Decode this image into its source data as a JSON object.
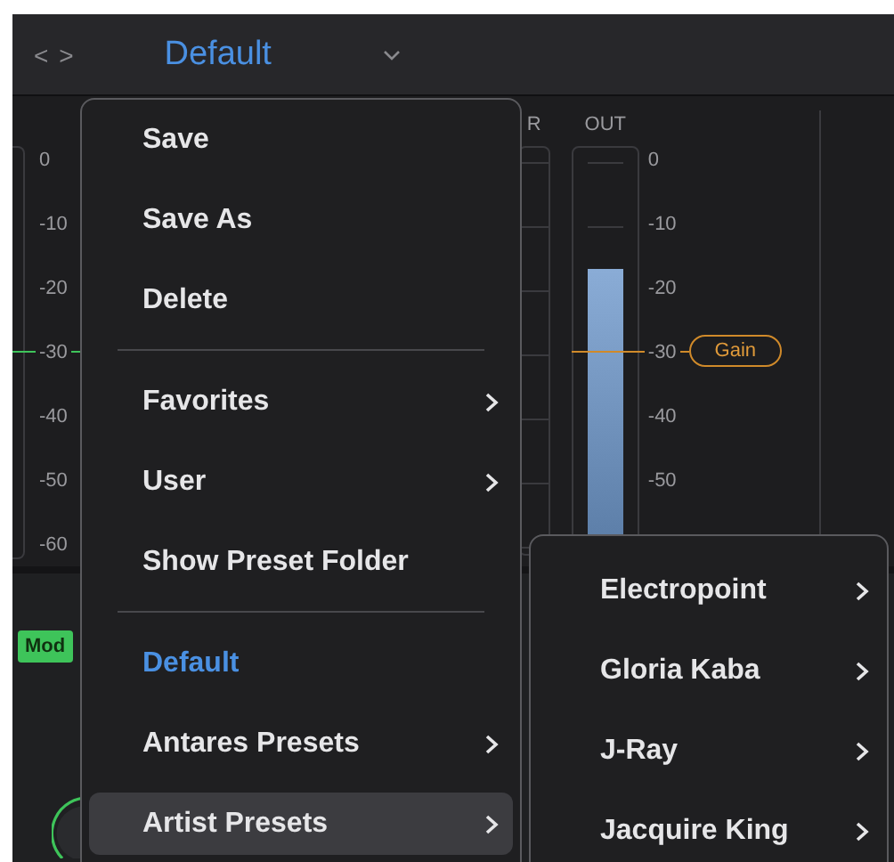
{
  "header": {
    "nav": "< >",
    "preset": "Default"
  },
  "left_meter": {
    "scale": [
      "0",
      "-10",
      "-20",
      "-30",
      "-40",
      "-50",
      "-60"
    ]
  },
  "mode_badge": "Mod",
  "right_meters": {
    "input_label": "R",
    "output": {
      "label": "OUT",
      "level": 0.7
    },
    "scale": [
      "0",
      "-10",
      "-20",
      "-30",
      "-40",
      "-50"
    ],
    "gain": "Gain"
  },
  "menu": {
    "items": [
      {
        "kind": "item",
        "label": "Save",
        "submenu": false,
        "current": false,
        "selected": false
      },
      {
        "kind": "item",
        "label": "Save As",
        "submenu": false,
        "current": false,
        "selected": false
      },
      {
        "kind": "item",
        "label": "Delete",
        "submenu": false,
        "current": false,
        "selected": false
      },
      {
        "kind": "divider"
      },
      {
        "kind": "item",
        "label": "Favorites",
        "submenu": true,
        "current": false,
        "selected": false
      },
      {
        "kind": "item",
        "label": "User",
        "submenu": true,
        "current": false,
        "selected": false
      },
      {
        "kind": "item",
        "label": "Show Preset Folder",
        "submenu": false,
        "current": false,
        "selected": false
      },
      {
        "kind": "divider"
      },
      {
        "kind": "item",
        "label": "Default",
        "submenu": false,
        "current": true,
        "selected": false
      },
      {
        "kind": "item",
        "label": "Antares Presets",
        "submenu": true,
        "current": false,
        "selected": false
      },
      {
        "kind": "item",
        "label": "Artist Presets",
        "submenu": true,
        "current": false,
        "selected": true
      }
    ]
  },
  "submenu": {
    "items": [
      {
        "label": "Electropoint",
        "submenu": true
      },
      {
        "label": "Gloria Kaba",
        "submenu": true
      },
      {
        "label": "J-Ray",
        "submenu": true
      },
      {
        "label": "Jacquire King",
        "submenu": true
      }
    ]
  }
}
